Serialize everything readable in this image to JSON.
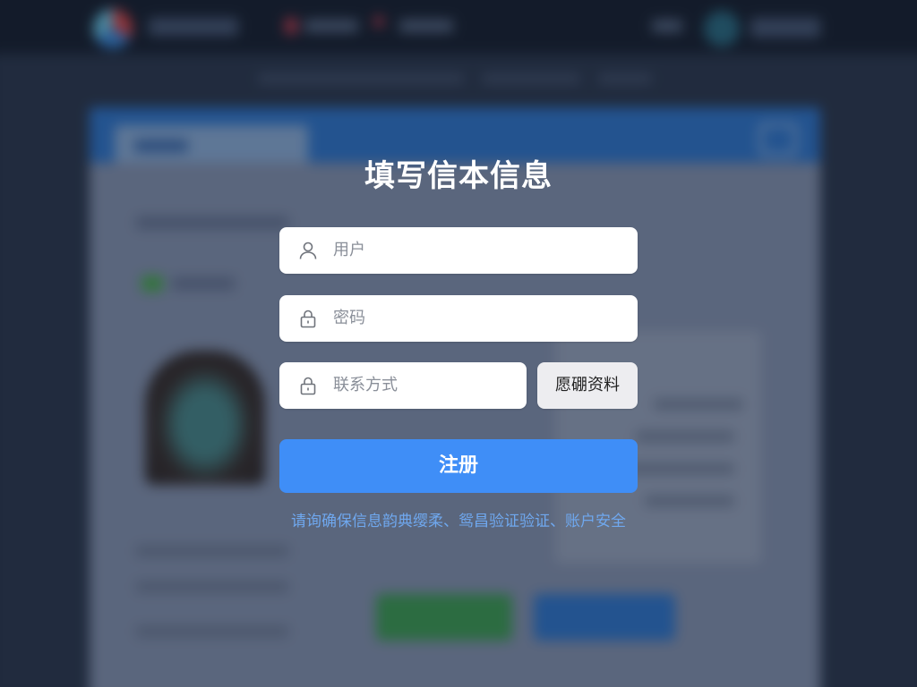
{
  "form": {
    "title": "填写信本信息",
    "username_placeholder": "用户",
    "password_placeholder": "密码",
    "contact_placeholder": "联系方式",
    "side_button_label": "愿硼资料",
    "submit_label": "注册",
    "hint_text": "请询确保信息韵典缨柔、鸳昌验证验证、账户安全"
  },
  "icons": {
    "user": "user-icon",
    "password": "lock-icon",
    "contact": "lock-icon"
  },
  "colors": {
    "primary": "#3f8ef7",
    "hint": "#6fa8ef",
    "title": "#ffffff"
  }
}
